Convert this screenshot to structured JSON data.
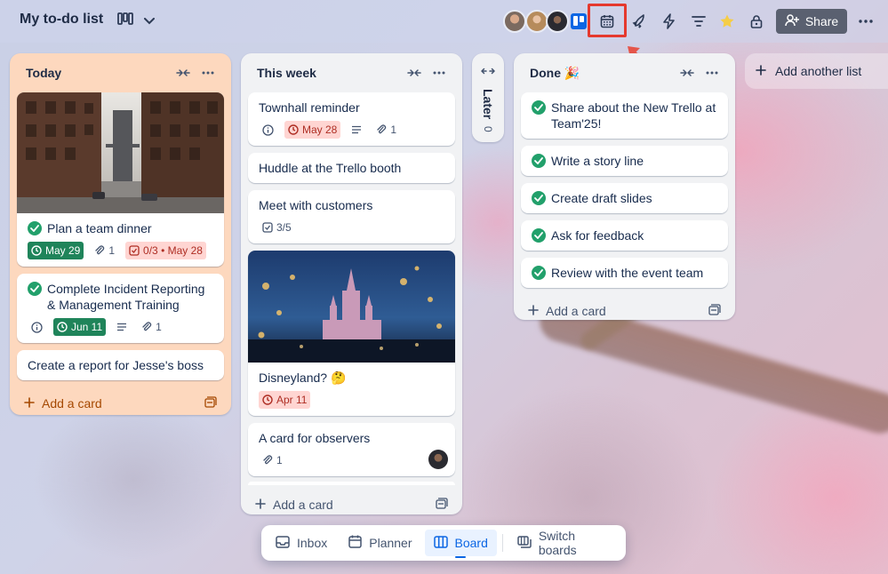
{
  "header": {
    "title": "My to-do list",
    "share_label": "Share",
    "icons": [
      "board-view-icon",
      "chevron-down-icon",
      "trello-icon",
      "calendar-icon",
      "power-up-icon",
      "automation-icon",
      "filter-icon",
      "star-icon",
      "lock-icon",
      "add-user-icon",
      "more-icon"
    ]
  },
  "lists": {
    "today": {
      "title": "Today",
      "cards": [
        {
          "title": "Plan a team dinner",
          "due": "May 29",
          "attachments": "1",
          "checklist": "0/3 • May 28"
        },
        {
          "title": "Complete Incident Reporting & Management Training",
          "due": "Jun 11",
          "attachments": "1"
        },
        {
          "title": "Create a report for Jesse's boss"
        }
      ],
      "add_card": "Add a card"
    },
    "this_week": {
      "title": "This week",
      "cards": [
        {
          "title": "Townhall reminder",
          "due": "May 28",
          "attachments": "1"
        },
        {
          "title": "Huddle at the Trello booth"
        },
        {
          "title": "Meet with customers",
          "checklist": "3/5"
        },
        {
          "title": "Disneyland? 🤔",
          "due": "Apr 11"
        },
        {
          "title": "A card for observers",
          "attachments": "1"
        }
      ],
      "add_card": "Add a card"
    },
    "later": {
      "title": "Later",
      "count": "0"
    },
    "done": {
      "title": "Done 🎉",
      "cards": [
        {
          "title": "Share about the New Trello at Team'25!"
        },
        {
          "title": "Write a story line"
        },
        {
          "title": "Create draft slides"
        },
        {
          "title": "Ask for feedback"
        },
        {
          "title": "Review with the event team"
        }
      ],
      "add_card": "Add a card"
    },
    "add_list": "Add another list"
  },
  "bottom_nav": {
    "inbox": "Inbox",
    "planner": "Planner",
    "board": "Board",
    "switch": "Switch boards",
    "active": "Board"
  },
  "colors": {
    "today_list_bg": "#fdd8be",
    "list_bg": "#f1f2f4",
    "due_red_bg": "#ffd5d2",
    "due_green_bg": "#1f845a",
    "check_green": "#22a06b",
    "highlight": "#e5392e",
    "active_blue": "#0c66e4"
  }
}
